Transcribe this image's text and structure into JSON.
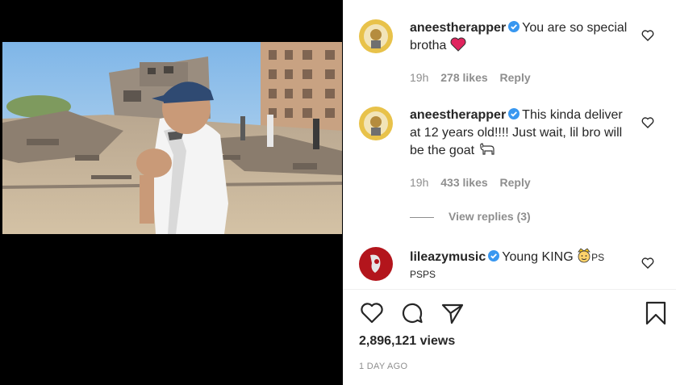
{
  "comments": [
    {
      "username": "aneestherapper",
      "text": "You are so special brotha",
      "emoji": "heart",
      "time": "19h",
      "likes": "278 likes",
      "reply": "Reply"
    },
    {
      "username": "aneestherapper",
      "text": "This kinda deliver at 12 years old!!!! Just wait, lil bro will be the goat",
      "emoji": "goat",
      "time": "19h",
      "likes": "433 likes",
      "reply": "Reply",
      "view_replies": "View replies (3)"
    },
    {
      "username": "lileazymusic",
      "text": "Young KING",
      "emoji": "crown-face",
      "text_after": "PS",
      "text_line2": "PSPS"
    }
  ],
  "post": {
    "views": "2,896,121 views",
    "date": "1 DAY AGO"
  },
  "colors": {
    "verified": "#3897f0",
    "heart_emoji": "#e0245e",
    "muted": "#8e8e8e",
    "text": "#262626"
  },
  "icons": [
    "heart-icon",
    "comment-icon",
    "share-icon",
    "bookmark-icon",
    "verified-icon"
  ]
}
